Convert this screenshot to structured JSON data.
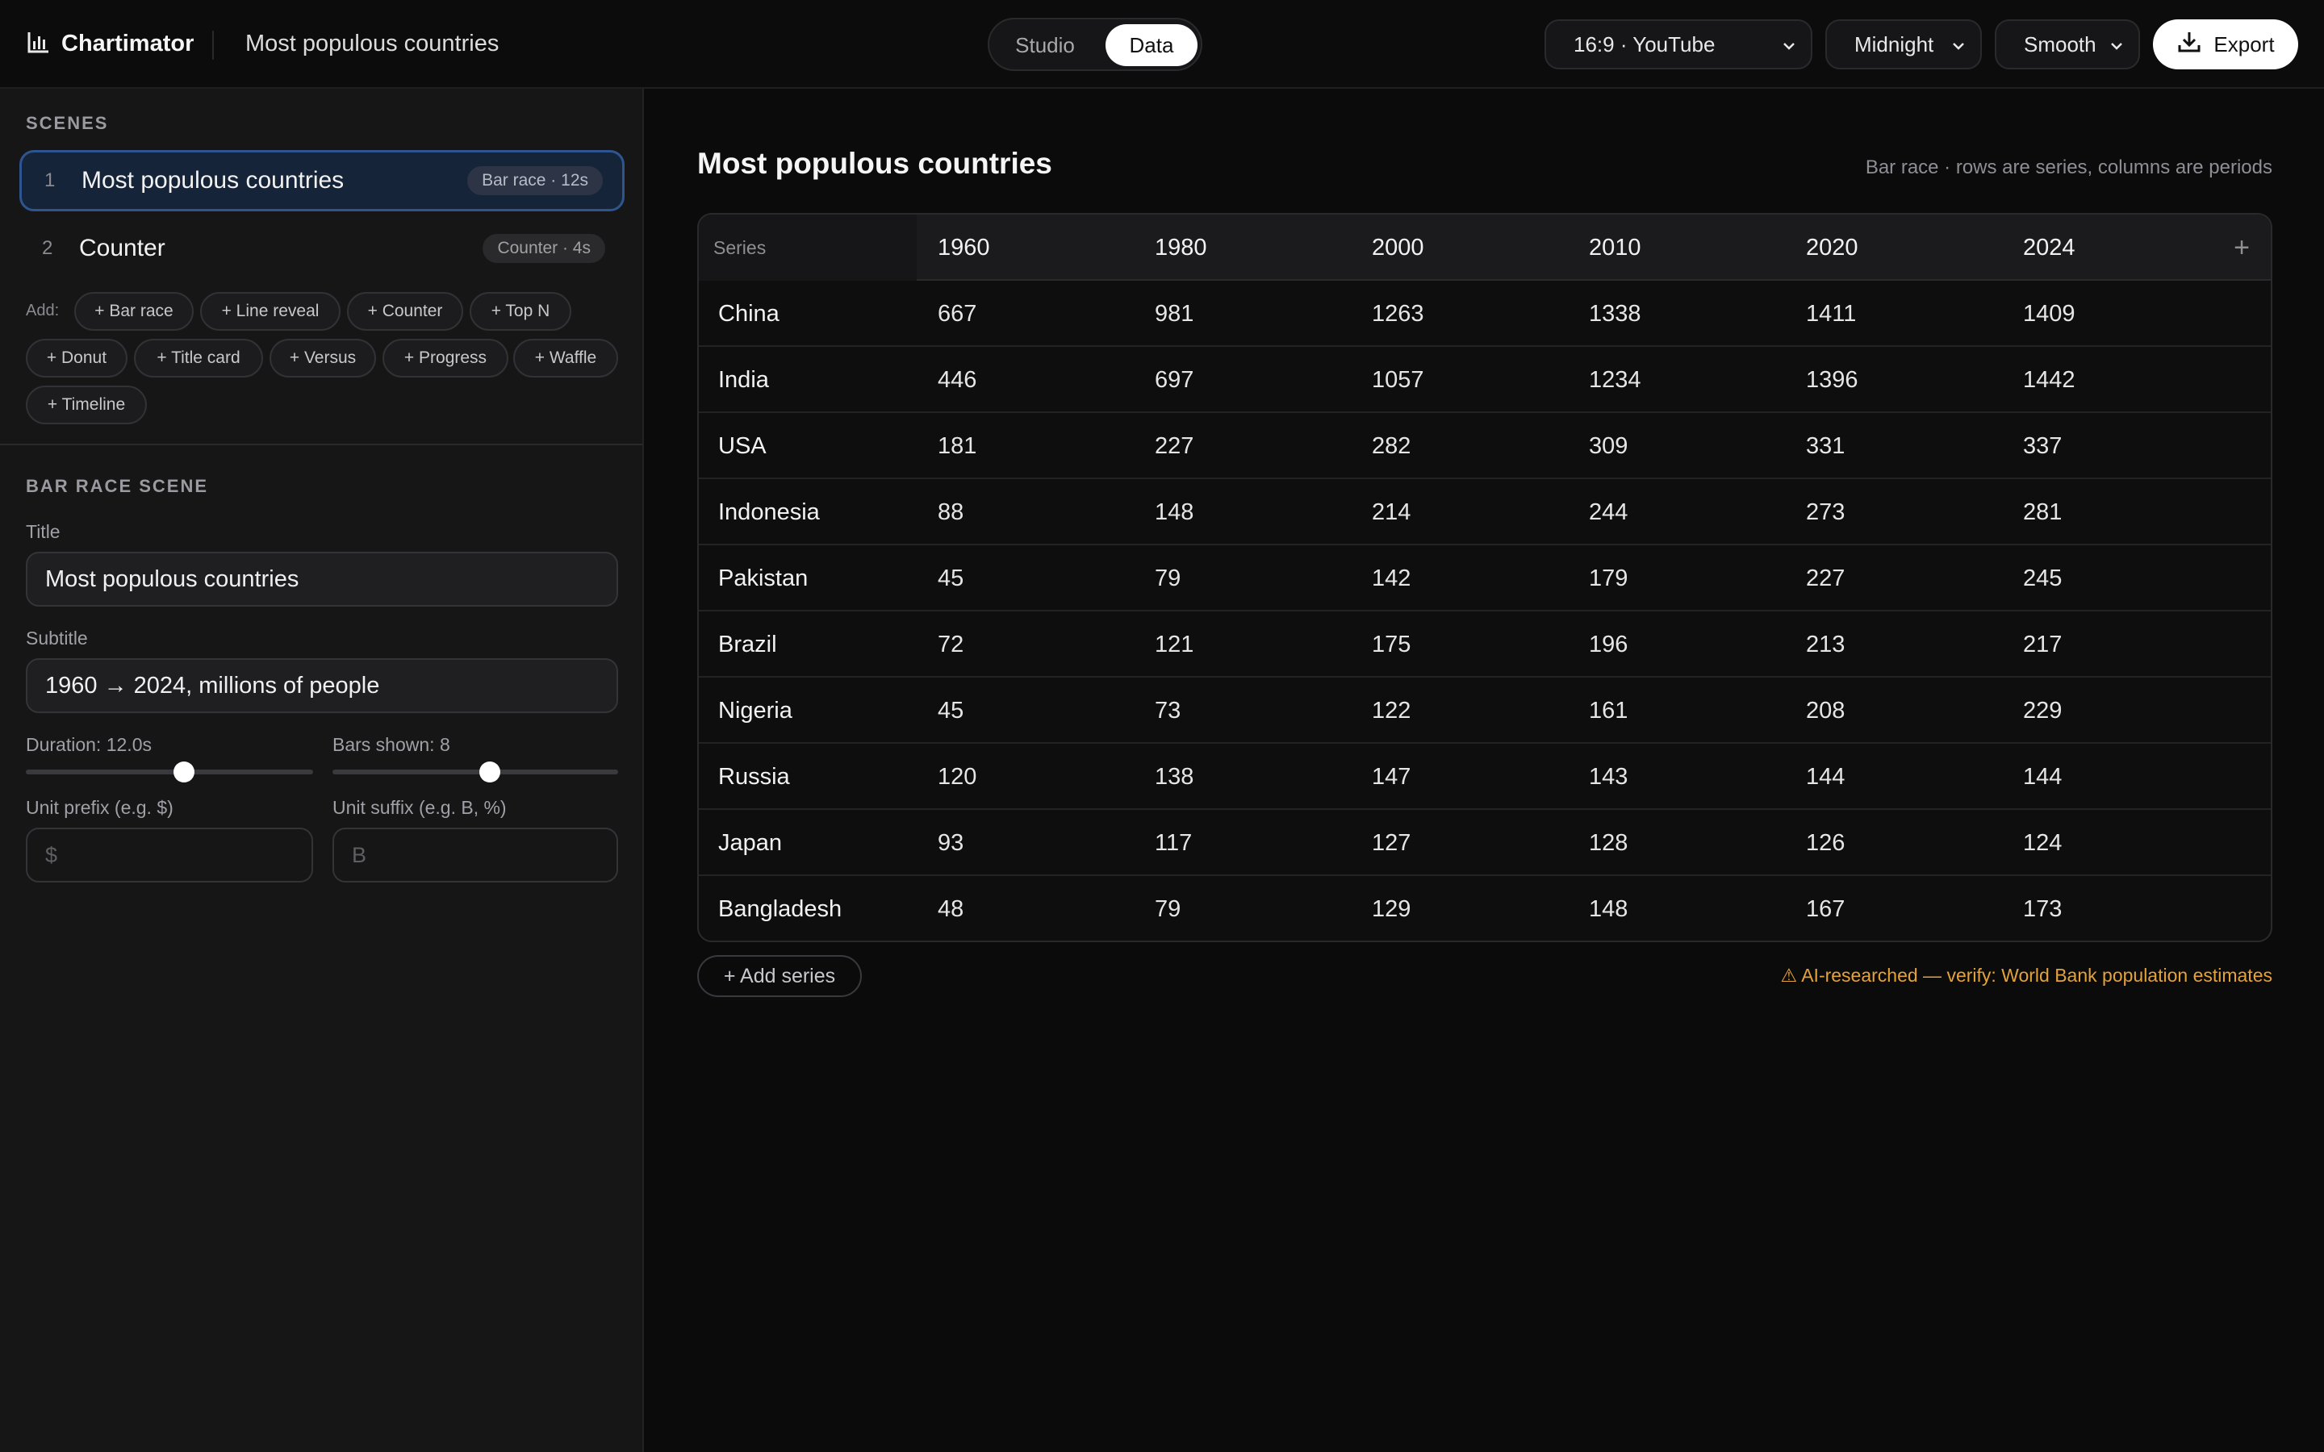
{
  "app": {
    "name": "Chartimator",
    "doc_title": "Most populous countries"
  },
  "view_toggle": {
    "studio": "Studio",
    "data": "Data",
    "active": "Data"
  },
  "controls": {
    "format": "16:9 · YouTube",
    "theme": "Midnight",
    "motion": "Smooth",
    "export": "Export"
  },
  "sidebar": {
    "scenes_heading": "SCENES",
    "scenes": [
      {
        "num": "1",
        "name": "Most populous countries",
        "badge": "Bar race · 12s",
        "active": true
      },
      {
        "num": "2",
        "name": "Counter",
        "badge": "Counter · 4s",
        "active": false
      }
    ],
    "add_label": "Add:",
    "add_types": [
      "Bar race",
      "Line reveal",
      "Counter",
      "Top N",
      "Donut",
      "Title card",
      "Versus",
      "Progress",
      "Waffle",
      "Timeline"
    ],
    "editor_heading": "BAR RACE SCENE",
    "title_label": "Title",
    "title_value": "Most populous countries",
    "subtitle_label": "Subtitle",
    "subtitle_value": "1960 → 2024, millions of people",
    "duration_label": "Duration: 12.0s",
    "duration_fraction": 0.55,
    "bars_label": "Bars shown: 8",
    "bars_fraction": 0.55,
    "prefix_label": "Unit prefix (e.g. $)",
    "prefix_placeholder": "$",
    "suffix_label": "Unit suffix (e.g. B, %)",
    "suffix_placeholder": "B"
  },
  "main": {
    "title": "Most populous countries",
    "hint": "Bar race · rows are series, columns are periods",
    "series_header": "Series",
    "add_column": "+",
    "columns": [
      "1960",
      "1980",
      "2000",
      "2010",
      "2020",
      "2024"
    ],
    "rows": [
      {
        "name": "China",
        "values": [
          "667",
          "981",
          "1263",
          "1338",
          "1411",
          "1409"
        ]
      },
      {
        "name": "India",
        "values": [
          "446",
          "697",
          "1057",
          "1234",
          "1396",
          "1442"
        ]
      },
      {
        "name": "USA",
        "values": [
          "181",
          "227",
          "282",
          "309",
          "331",
          "337"
        ]
      },
      {
        "name": "Indonesia",
        "values": [
          "88",
          "148",
          "214",
          "244",
          "273",
          "281"
        ]
      },
      {
        "name": "Pakistan",
        "values": [
          "45",
          "79",
          "142",
          "179",
          "227",
          "245"
        ]
      },
      {
        "name": "Brazil",
        "values": [
          "72",
          "121",
          "175",
          "196",
          "213",
          "217"
        ]
      },
      {
        "name": "Nigeria",
        "values": [
          "45",
          "73",
          "122",
          "161",
          "208",
          "229"
        ]
      },
      {
        "name": "Russia",
        "values": [
          "120",
          "138",
          "147",
          "143",
          "144",
          "144"
        ]
      },
      {
        "name": "Japan",
        "values": [
          "93",
          "117",
          "127",
          "128",
          "126",
          "124"
        ]
      },
      {
        "name": "Bangladesh",
        "values": [
          "48",
          "79",
          "129",
          "148",
          "167",
          "173"
        ]
      }
    ],
    "add_series": "+ Add series",
    "warning": "⚠ AI-researched — verify: World Bank population estimates"
  }
}
